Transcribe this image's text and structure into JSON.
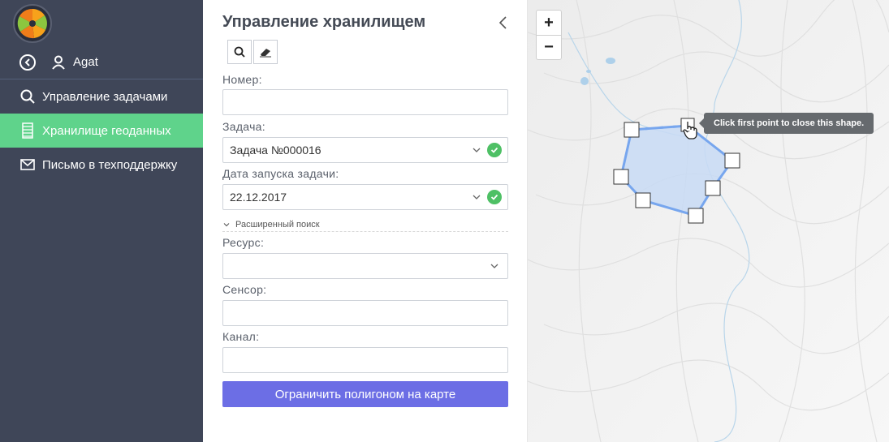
{
  "sidebar": {
    "user_name": "Agat",
    "items": [
      {
        "label": "Управление задачами",
        "icon": "search-icon"
      },
      {
        "label": "Хранилище геоданных",
        "icon": "storage-icon",
        "active": true
      },
      {
        "label": "Письмо в техподдержку",
        "icon": "mail-icon"
      }
    ],
    "colors": {
      "background": "#3f4658",
      "active": "#5fd38b"
    }
  },
  "panel": {
    "title": "Управление хранилищем",
    "fields": {
      "number": {
        "label": "Номер:",
        "value": ""
      },
      "task": {
        "label": "Задача:",
        "value": "Задача №000016"
      },
      "date": {
        "label": "Дата запуска задачи:",
        "value": "22.12.2017"
      },
      "resource": {
        "label": "Ресурс:",
        "value": ""
      },
      "sensor": {
        "label": "Сенсор:",
        "value": ""
      },
      "channel": {
        "label": "Канал:",
        "value": ""
      }
    },
    "advanced_search": "Расширенный поиск",
    "submit_label": "Ограничить полигоном на карте",
    "colors": {
      "button": "#6c6ee5",
      "ok": "#4ec065"
    }
  },
  "map": {
    "zoom_in": "+",
    "zoom_out": "−",
    "tooltip": "Click first point to close this shape.",
    "colors": {
      "polygon_fill": "#c8daf5",
      "polygon_stroke": "#77a6ee"
    }
  }
}
